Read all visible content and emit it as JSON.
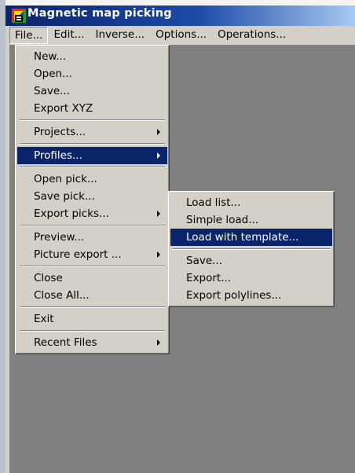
{
  "window": {
    "title": "Magnetic map picking",
    "icon": "app-map-icon"
  },
  "menubar": {
    "items": [
      {
        "label": "File...",
        "active": true
      },
      {
        "label": "Edit..."
      },
      {
        "label": "Inverse..."
      },
      {
        "label": "Options..."
      },
      {
        "label": "Operations..."
      }
    ]
  },
  "file_menu": {
    "items": [
      {
        "label": "New..."
      },
      {
        "label": "Open..."
      },
      {
        "label": "Save..."
      },
      {
        "label": "Export XYZ"
      },
      {
        "label": "Projects..."
      },
      {
        "label": "Profiles..."
      },
      {
        "label": "Open pick..."
      },
      {
        "label": "Save pick..."
      },
      {
        "label": "Export picks..."
      },
      {
        "label": "Preview..."
      },
      {
        "label": "Picture export ..."
      },
      {
        "label": "Close"
      },
      {
        "label": "Close All..."
      },
      {
        "label": "Exit"
      },
      {
        "label": "Recent Files"
      }
    ]
  },
  "profiles_menu": {
    "items": [
      {
        "label": "Load list..."
      },
      {
        "label": "Simple load..."
      },
      {
        "label": "Load with template..."
      },
      {
        "label": "Save..."
      },
      {
        "label": "Export..."
      },
      {
        "label": "Export polylines..."
      }
    ]
  },
  "colors": {
    "title_gradient_start": "#0a246a",
    "title_gradient_end": "#a6caf0",
    "menu_face": "#d4d0c8",
    "selection": "#0a246a",
    "workspace": "#808080"
  }
}
